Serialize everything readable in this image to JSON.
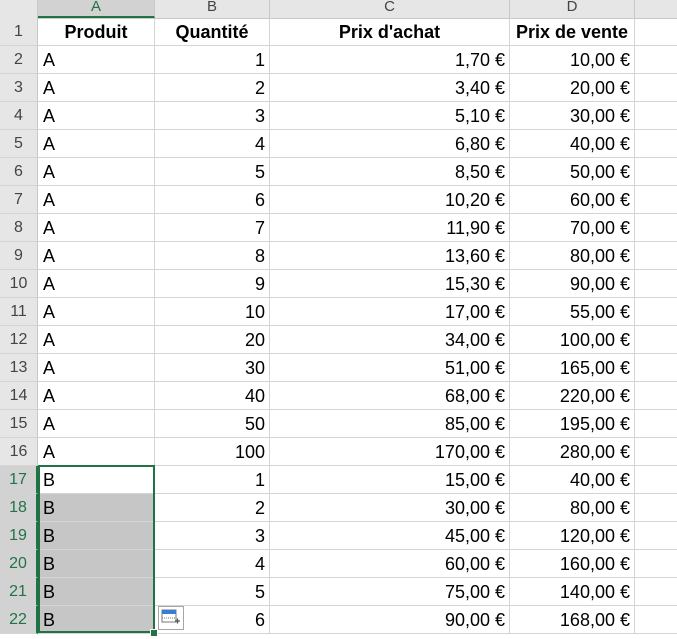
{
  "sheet": {
    "columns": [
      "A",
      "B",
      "C",
      "D"
    ],
    "headers": {
      "produit": "Produit",
      "quantite": "Quantité",
      "prix_achat": "Prix d'achat",
      "prix_vente": "Prix de vente"
    },
    "rows": [
      {
        "num": "2",
        "produit": "A",
        "quantite": "1",
        "achat": "1,70 €",
        "vente": "10,00 €"
      },
      {
        "num": "3",
        "produit": "A",
        "quantite": "2",
        "achat": "3,40 €",
        "vente": "20,00 €"
      },
      {
        "num": "4",
        "produit": "A",
        "quantite": "3",
        "achat": "5,10 €",
        "vente": "30,00 €"
      },
      {
        "num": "5",
        "produit": "A",
        "quantite": "4",
        "achat": "6,80 €",
        "vente": "40,00 €"
      },
      {
        "num": "6",
        "produit": "A",
        "quantite": "5",
        "achat": "8,50 €",
        "vente": "50,00 €"
      },
      {
        "num": "7",
        "produit": "A",
        "quantite": "6",
        "achat": "10,20 €",
        "vente": "60,00 €"
      },
      {
        "num": "8",
        "produit": "A",
        "quantite": "7",
        "achat": "11,90 €",
        "vente": "70,00 €"
      },
      {
        "num": "9",
        "produit": "A",
        "quantite": "8",
        "achat": "13,60 €",
        "vente": "80,00 €"
      },
      {
        "num": "10",
        "produit": "A",
        "quantite": "9",
        "achat": "15,30 €",
        "vente": "90,00 €"
      },
      {
        "num": "11",
        "produit": "A",
        "quantite": "10",
        "achat": "17,00 €",
        "vente": "55,00 €"
      },
      {
        "num": "12",
        "produit": "A",
        "quantite": "20",
        "achat": "34,00 €",
        "vente": "100,00 €"
      },
      {
        "num": "13",
        "produit": "A",
        "quantite": "30",
        "achat": "51,00 €",
        "vente": "165,00 €"
      },
      {
        "num": "14",
        "produit": "A",
        "quantite": "40",
        "achat": "68,00 €",
        "vente": "220,00 €"
      },
      {
        "num": "15",
        "produit": "A",
        "quantite": "50",
        "achat": "85,00 €",
        "vente": "195,00 €"
      },
      {
        "num": "16",
        "produit": "A",
        "quantite": "100",
        "achat": "170,00 €",
        "vente": "280,00 €"
      },
      {
        "num": "17",
        "produit": "B",
        "quantite": "1",
        "achat": "15,00 €",
        "vente": "40,00 €"
      },
      {
        "num": "18",
        "produit": "B",
        "quantite": "2",
        "achat": "30,00 €",
        "vente": "80,00 €"
      },
      {
        "num": "19",
        "produit": "B",
        "quantite": "3",
        "achat": "45,00 €",
        "vente": "120,00 €"
      },
      {
        "num": "20",
        "produit": "B",
        "quantite": "4",
        "achat": "60,00 €",
        "vente": "160,00 €"
      },
      {
        "num": "21",
        "produit": "B",
        "quantite": "5",
        "achat": "75,00 €",
        "vente": "140,00 €"
      },
      {
        "num": "22",
        "produit": "B",
        "quantite": "6",
        "achat": "90,00 €",
        "vente": "168,00 €"
      }
    ],
    "header_row_num": "1",
    "selected_column": "A",
    "selected_rows": [
      "17",
      "22"
    ],
    "icons": {
      "quick_analysis": "quick-analysis-icon"
    },
    "colors": {
      "selection": "#217346",
      "header_bg": "#e6e6e6",
      "shaded": "#c6c6c6"
    }
  }
}
